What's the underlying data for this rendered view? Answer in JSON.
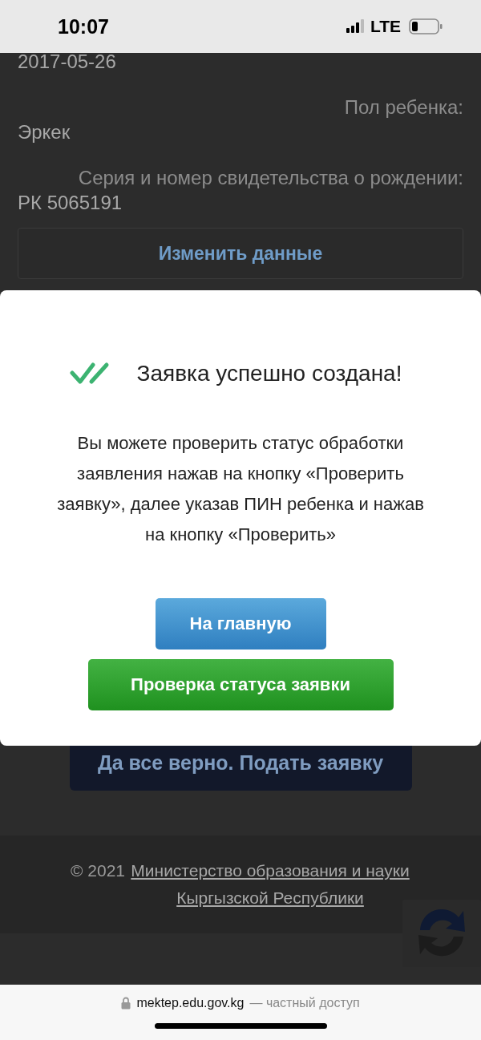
{
  "status_bar": {
    "time": "10:07",
    "network": "LTE"
  },
  "page": {
    "lines": [
      {
        "kind": "value",
        "text": "2017-05-26"
      },
      {
        "kind": "label",
        "text": "Пол ребенка:"
      },
      {
        "kind": "value",
        "text": "Эркек"
      },
      {
        "kind": "label",
        "text": "Серия и номер свидетельства о рождении:"
      },
      {
        "kind": "value",
        "text": "РК 5065191"
      }
    ],
    "edit_button": "Изменить данные",
    "submit_button": "Да все верно. Подать заявку",
    "footer": {
      "copyright": "© 2021",
      "link": "Министерство образования и науки Кыргызской Республики"
    }
  },
  "modal": {
    "title": "Заявка успешно создана!",
    "message": "Вы можете проверить статус обработки заявления нажав на кнопку «Проверить заявку», далее указав ПИН ребенка и нажав на кнопку «Проверить»",
    "buttons": [
      {
        "label": "На главную",
        "kind": "primary"
      },
      {
        "label": "Проверка статуса заявки",
        "kind": "success"
      }
    ]
  },
  "browser_bar": {
    "domain": "mektep.edu.gov.kg",
    "note": "— частный доступ"
  }
}
